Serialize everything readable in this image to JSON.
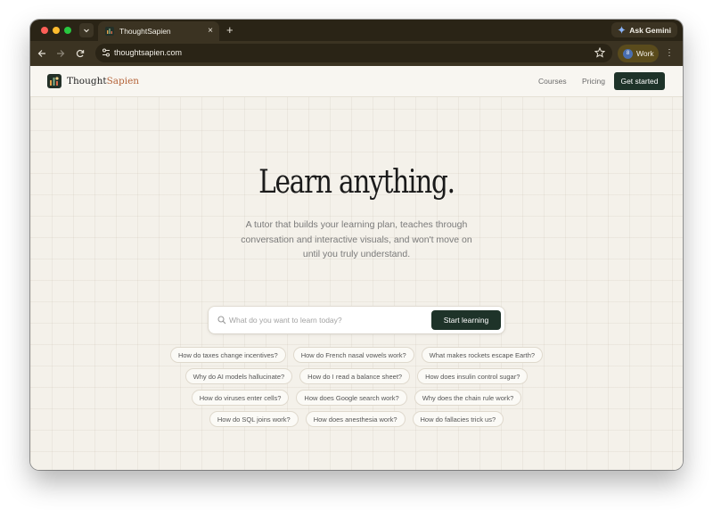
{
  "browser": {
    "tab_title": "ThoughtSapien",
    "new_tab_symbol": "+",
    "close_symbol": "×",
    "gemini_label": "Ask Gemini",
    "url": "thoughtsapien.com",
    "profile_label": "Work",
    "profile_initial": "8",
    "menu_symbol": "⋮"
  },
  "site": {
    "brand_main": "Thought",
    "brand_accent": "Sapien",
    "nav": {
      "courses": "Courses",
      "pricing": "Pricing",
      "cta": "Get started"
    }
  },
  "hero": {
    "title": "Learn anything.",
    "subtitle": "A tutor that builds your learning plan, teaches through conversation and interactive visuals, and won't move on until you truly understand."
  },
  "search": {
    "placeholder": "What do you want to learn today?",
    "button": "Start learning"
  },
  "suggestions": [
    [
      "How do taxes change incentives?",
      "How do French nasal vowels work?",
      "What makes rockets escape Earth?"
    ],
    [
      "Why do AI models hallucinate?",
      "How do I read a balance sheet?",
      "How does insulin control sugar?"
    ],
    [
      "How do viruses enter cells?",
      "How does Google search work?",
      "Why does the chain rule work?"
    ],
    [
      "How do SQL joins work?",
      "How does anesthesia work?",
      "How do fallacies trick us?"
    ]
  ],
  "colors": {
    "accent_dark_green": "#1e3329",
    "brand_accent": "#b5643a",
    "browser_chrome": "#2a2416",
    "page_background": "#f4f1ea"
  },
  "icons": [
    "tab-search-icon",
    "favicon-icon",
    "gemini-icon",
    "back-icon",
    "forward-icon",
    "reload-icon",
    "site-settings-icon",
    "bookmark-star-icon",
    "search-icon",
    "logo-icon"
  ]
}
